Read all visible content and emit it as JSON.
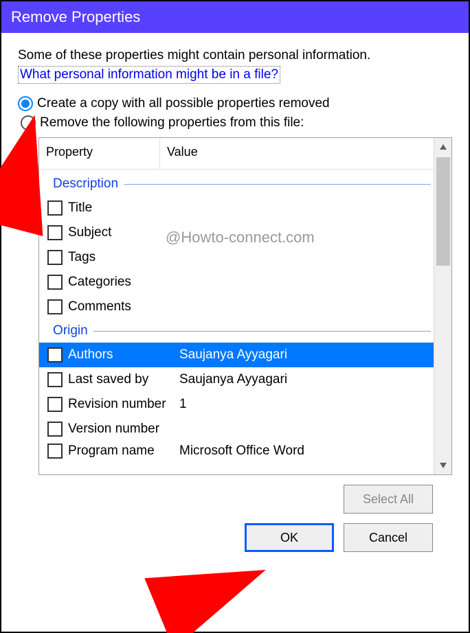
{
  "window": {
    "title": "Remove Properties"
  },
  "intro": "Some of these properties might contain personal information.",
  "link": "What personal information might be in a file?",
  "options": {
    "copy": "Create a copy with all possible properties removed",
    "remove": "Remove the following properties from this file:"
  },
  "columns": {
    "property": "Property",
    "value": "Value"
  },
  "groups": {
    "description": {
      "label": "Description",
      "items": [
        {
          "name": "Title",
          "value": ""
        },
        {
          "name": "Subject",
          "value": ""
        },
        {
          "name": "Tags",
          "value": ""
        },
        {
          "name": "Categories",
          "value": ""
        },
        {
          "name": "Comments",
          "value": ""
        }
      ]
    },
    "origin": {
      "label": "Origin",
      "items": [
        {
          "name": "Authors",
          "value": "Saujanya Ayyagari",
          "selected": true
        },
        {
          "name": "Last saved by",
          "value": "Saujanya Ayyagari"
        },
        {
          "name": "Revision number",
          "value": "1"
        },
        {
          "name": "Version number",
          "value": ""
        },
        {
          "name": "Program name",
          "value": "Microsoft Office Word"
        }
      ]
    }
  },
  "buttons": {
    "select_all": "Select All",
    "ok": "OK",
    "cancel": "Cancel"
  },
  "watermark": "@Howto-connect.com"
}
